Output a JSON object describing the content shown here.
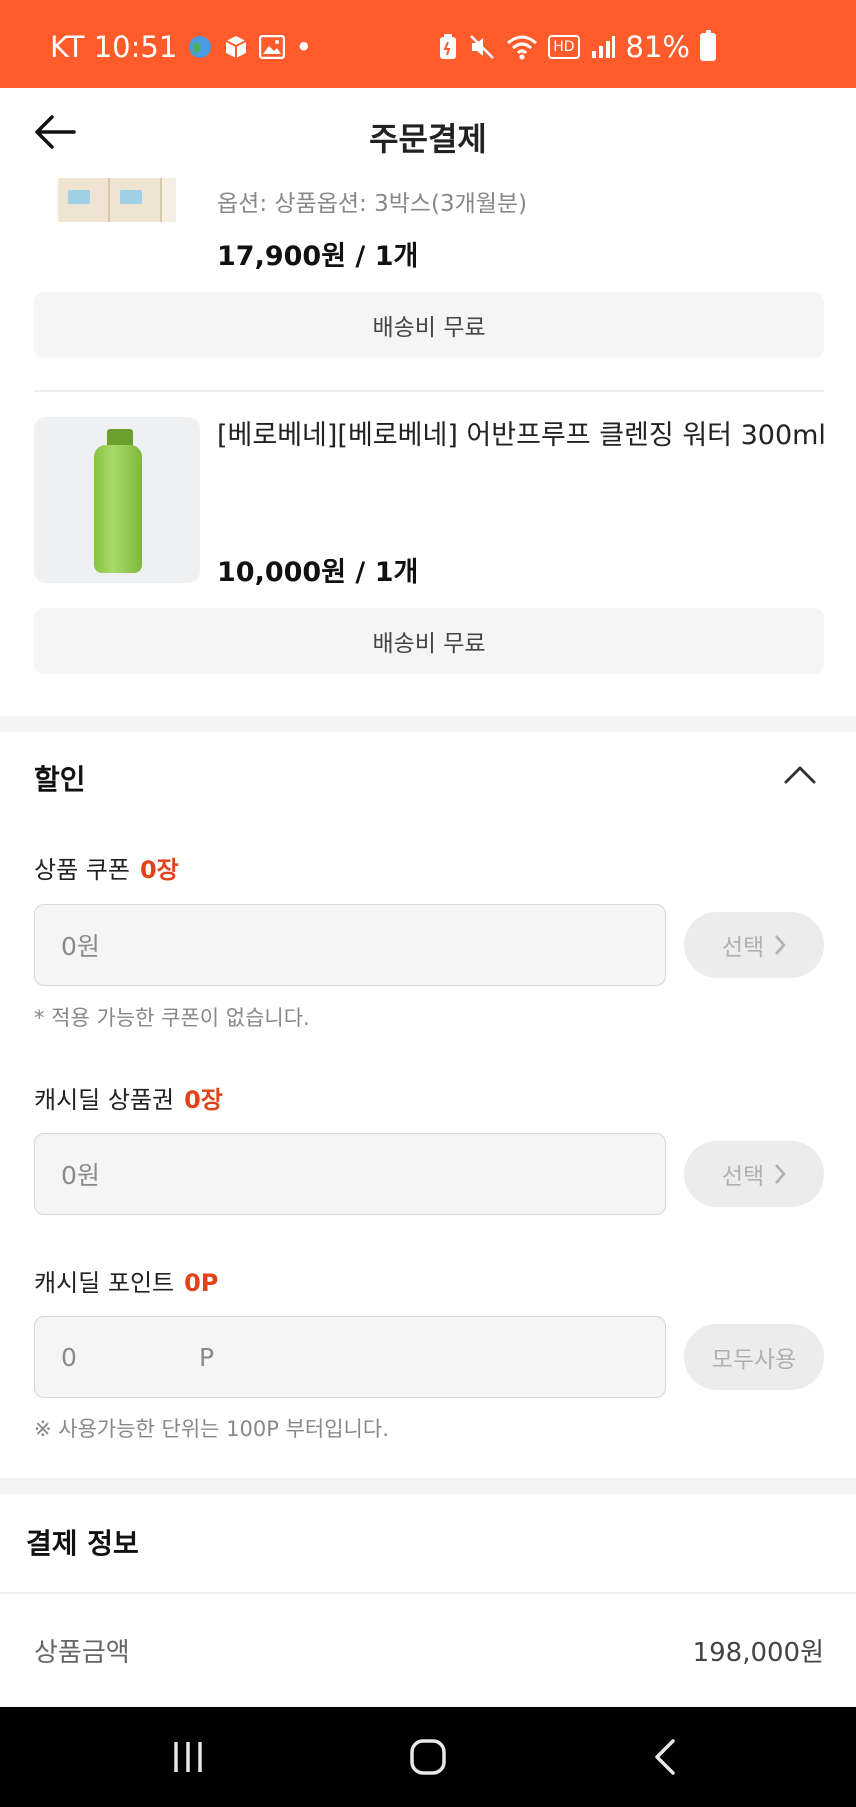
{
  "status_bar": {
    "carrier_time": "KT 10:51",
    "battery": "81%",
    "hd_label": "HD",
    "dot": "•",
    "colors": {
      "background": "#ff5b2b"
    }
  },
  "header": {
    "title": "주문결제",
    "back_icon": "arrow-left-icon"
  },
  "products": [
    {
      "option": "옵션: 상품옵션: 3박스(3개월분)",
      "price": "17,900원 / 1개",
      "shipping": "배송비 무료"
    },
    {
      "title": "[베로베네][베로베네] 어반프루프 클렌징 워터 300ml",
      "price": "10,000원 / 1개",
      "shipping": "배송비 무료"
    }
  ],
  "discount": {
    "title": "할인",
    "coupon": {
      "label": "상품 쿠폰",
      "count": "0장",
      "value": "0원",
      "button": "선택",
      "hint": "* 적용 가능한 쿠폰이 없습니다."
    },
    "voucher": {
      "label": "캐시딜 상품권",
      "count": "0장",
      "value": "0원",
      "button": "선택"
    },
    "point": {
      "label": "캐시딜 포인트",
      "count": "0P",
      "value": "0",
      "unit": "P",
      "button": "모두사용",
      "hint": "※ 사용가능한 단위는 100P 부터입니다."
    },
    "accent_color": "#e0431a"
  },
  "payment": {
    "title": "결제 정보",
    "rows": [
      {
        "label": "상품금액",
        "value": "198,000원"
      }
    ]
  },
  "nav": {
    "recent_icon": "recent-apps-icon",
    "home_icon": "home-icon",
    "back_icon": "back-icon"
  }
}
